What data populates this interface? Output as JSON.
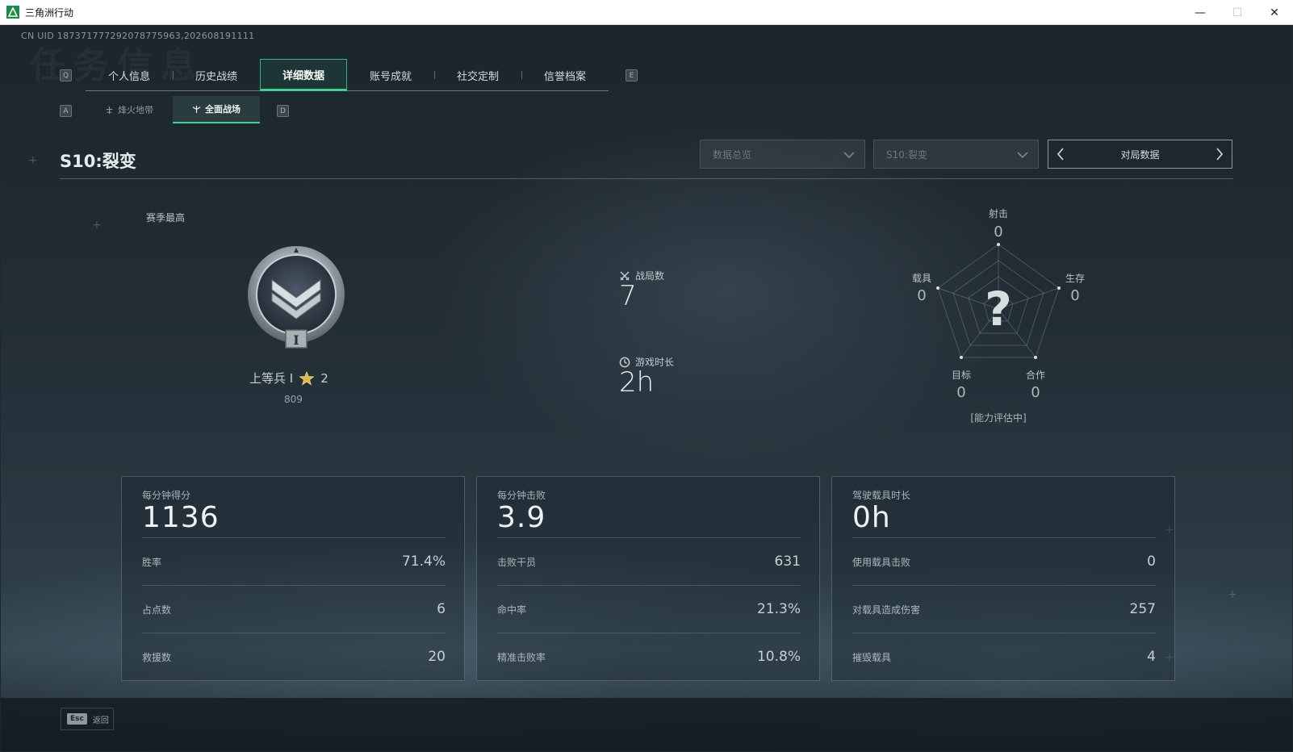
{
  "window": {
    "title": "三角洲行动",
    "minimize": "—",
    "maximize": "☐",
    "close": "✕"
  },
  "uid": "CN UID 1873717772920787759​63,202608191111",
  "ghost_title": "任务信息",
  "nav": {
    "prev_key": "Q",
    "next_key": "E",
    "tabs": [
      {
        "label": "个人信息"
      },
      {
        "label": "历史战绩"
      },
      {
        "label": "详细数据",
        "active": true
      },
      {
        "label": "账号成就"
      },
      {
        "label": "社交定制"
      },
      {
        "label": "信誉档案"
      }
    ]
  },
  "subnav": {
    "prev_key": "A",
    "next_key": "D",
    "tabs": [
      {
        "label": "烽火地带"
      },
      {
        "label": "全面战场",
        "active": true
      }
    ]
  },
  "season": {
    "title": "S10:裂变",
    "filter_overview": "数据总览",
    "filter_season": "S10:裂变",
    "pager_label": "对局数据"
  },
  "rank": {
    "season_high_label": "赛季最高",
    "name": "上等兵 I",
    "stars": "2",
    "score": "809",
    "tier_numeral": "I"
  },
  "summary": {
    "matches_label": "战局数",
    "matches_value": "7",
    "playtime_label": "游戏时长",
    "playtime_value": "2h"
  },
  "radar": {
    "center_mark": "?",
    "status": "[能力评估中]",
    "axes": [
      {
        "label": "射击",
        "value": "0"
      },
      {
        "label": "生存",
        "value": "0"
      },
      {
        "label": "合作",
        "value": "0"
      },
      {
        "label": "目标",
        "value": "0"
      },
      {
        "label": "载具",
        "value": "0"
      }
    ]
  },
  "panels": [
    {
      "label": "每分钟得分",
      "value": "1136",
      "rows": [
        {
          "label": "胜率",
          "value": "71.4%"
        },
        {
          "label": "占点数",
          "value": "6"
        },
        {
          "label": "救援数",
          "value": "20"
        }
      ]
    },
    {
      "label": "每分钟击败",
      "value": "3.9",
      "rows": [
        {
          "label": "击败干员",
          "value": "631"
        },
        {
          "label": "命中率",
          "value": "21.3%"
        },
        {
          "label": "精准击败率",
          "value": "10.8%"
        }
      ]
    },
    {
      "label": "驾驶载具时长",
      "value": "0h",
      "rows": [
        {
          "label": "使用载具击败",
          "value": "0"
        },
        {
          "label": "对载具造成伤害",
          "value": "257"
        },
        {
          "label": "摧毁载具",
          "value": "4"
        }
      ]
    }
  ],
  "footer": {
    "esc_key": "Esc",
    "back_label": "返回"
  }
}
